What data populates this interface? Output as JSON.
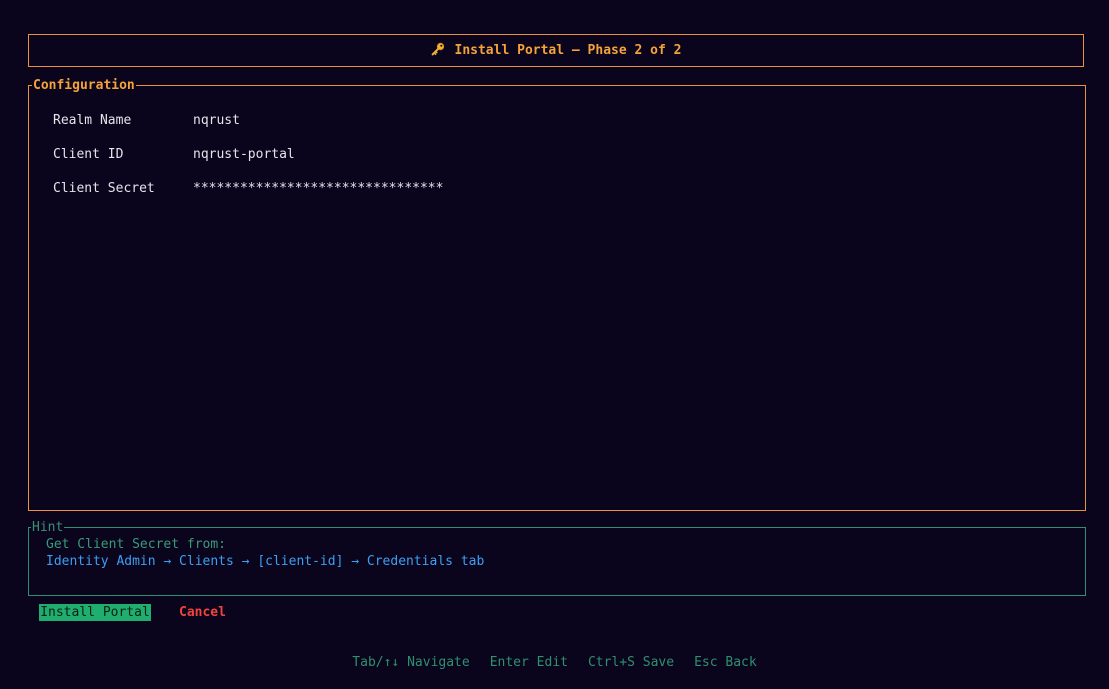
{
  "header": {
    "icon": "key-icon",
    "title": "Install Portal — Phase 2 of 2"
  },
  "config": {
    "legend": "Configuration",
    "fields": [
      {
        "label": "Realm Name",
        "value": "nqrust"
      },
      {
        "label": "Client ID",
        "value": "nqrust-portal"
      },
      {
        "label": "Client Secret",
        "value": "********************************"
      }
    ]
  },
  "hint": {
    "legend": "Hint",
    "line1": "Get Client Secret from:",
    "line2": "Identity Admin → Clients → [client-id] → Credentials tab"
  },
  "actions": {
    "install_label": "Install Portal",
    "cancel_label": "Cancel"
  },
  "footer": {
    "items": [
      "Tab/↑↓ Navigate",
      "Enter Edit",
      "Ctrl+S Save",
      "Esc Back"
    ]
  },
  "colors": {
    "background": "#0a051c",
    "accent_orange": "#f5a23a",
    "hint_green": "#3a9a7a",
    "link_blue": "#3d9ef2",
    "button_green": "#1fae6e",
    "cancel_red": "#f0443c"
  }
}
